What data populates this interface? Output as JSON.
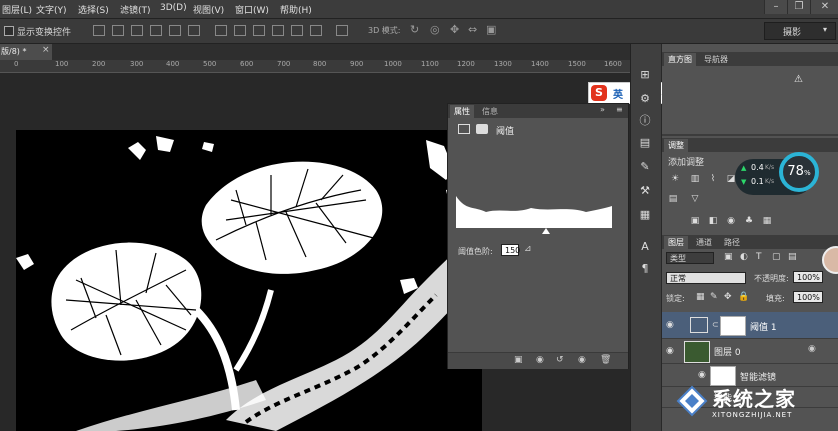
{
  "menubar": {
    "items": [
      "图层(L)",
      "文字(Y)",
      "选择(S)",
      "滤镜(T)",
      "3D(D)",
      "视图(V)",
      "窗口(W)",
      "帮助(H)"
    ]
  },
  "options_bar": {
    "show_transform_controls": "显示变换控件",
    "mode_3d": "3D 模式:",
    "workspace": "摄影"
  },
  "document": {
    "tab_title": "版/8) *",
    "ruler_ticks": [
      "0",
      "100",
      "200",
      "300",
      "400",
      "500",
      "600",
      "700",
      "800",
      "900",
      "1000",
      "1100",
      "1200",
      "1300",
      "1400",
      "1500",
      "1600"
    ]
  },
  "ime_bar": {
    "logo": "S",
    "lang": "英",
    "glyphs": [
      "☽",
      "°,",
      "🎤",
      "⌨",
      "👤",
      "👕",
      "🔧"
    ]
  },
  "properties_panel": {
    "tabs": [
      "属性",
      "信息"
    ],
    "title": "阈值",
    "threshold_label": "阈值色阶:",
    "threshold_value": "150"
  },
  "histogram_panel": {
    "tabs": [
      "直方图",
      "导航器"
    ],
    "warning_glyph": "⚠"
  },
  "adjustments_panel": {
    "tab": "调整",
    "add_label": "添加调整"
  },
  "speed_widget": {
    "up": "0.4",
    "down": "0.1",
    "unit": "K/s",
    "percent": "78",
    "percent_sign": "%"
  },
  "layers_panel": {
    "tabs": [
      "图层",
      "通道",
      "路径"
    ],
    "kind_filter": "类型",
    "blend_mode": "正常",
    "opacity_label": "不透明度:",
    "opacity_value": "100%",
    "lock_label": "锁定:",
    "fill_label": "填充:",
    "fill_value": "100%",
    "layers": [
      {
        "name": "阈值 1"
      },
      {
        "name": "图层 0"
      },
      {
        "name": "智能滤镜"
      },
      {
        "name": "智能..."
      }
    ]
  },
  "watermark": {
    "title": "系统之家",
    "url": "XITONGZHIJIA.NET"
  },
  "colors": {
    "ui_dark": "#282828",
    "panel": "#535353",
    "accent_blue": "#2bb4d6",
    "selected_layer": "#4b5f7a"
  }
}
